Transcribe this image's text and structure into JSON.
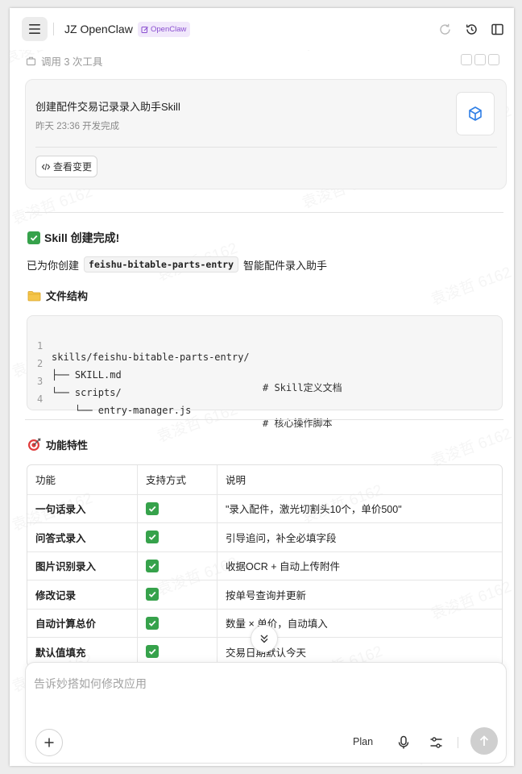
{
  "header": {
    "app_title": "JZ OpenClaw",
    "tag_label": "OpenClaw"
  },
  "tool_call": {
    "label": "调用 3 次工具"
  },
  "card": {
    "title": "创建配件交易记录录入助手Skill",
    "subtitle": "昨天 23:36 开发完成",
    "view_changes_label": "查看变更"
  },
  "message": {
    "done_heading": "Skill 创建完成!",
    "created_prefix": "已为你创建",
    "skill_name": "feishu-bitable-parts-entry",
    "created_suffix": "智能配件录入助手",
    "files_heading": "文件结构",
    "features_heading": "功能特性"
  },
  "code": {
    "lines": [
      {
        "num": "1",
        "text": "skills/feishu-bitable-parts-entry/",
        "comment": ""
      },
      {
        "num": "2",
        "text": "├── SKILL.md",
        "comment": "# Skill定义文档"
      },
      {
        "num": "3",
        "text": "└── scripts/",
        "comment": ""
      },
      {
        "num": "4",
        "text": "    └── entry-manager.js",
        "comment": "# 核心操作脚本"
      }
    ]
  },
  "table": {
    "headers": [
      "功能",
      "支持方式",
      "说明"
    ],
    "rows": [
      {
        "feature": "一句话录入",
        "support": "✅",
        "desc": "\"录入配件，激光切割头10个，单价500\""
      },
      {
        "feature": "问答式录入",
        "support": "✅",
        "desc": "引导追问，补全必填字段"
      },
      {
        "feature": "图片识别录入",
        "support": "✅",
        "desc": "收据OCR + 自动上传附件"
      },
      {
        "feature": "修改记录",
        "support": "✅",
        "desc": "按单号查询并更新"
      },
      {
        "feature": "自动计算总价",
        "support": "✅",
        "desc": "数量 × 单价，自动填入"
      },
      {
        "feature": "默认值填充",
        "support": "✅",
        "desc": "交易日期默认今天"
      }
    ]
  },
  "composer": {
    "placeholder": "告诉妙搭如何修改应用",
    "plan_label": "Plan"
  },
  "watermark": "袁浚哲 6162",
  "colors": {
    "accent": "#8a4fd0",
    "check_green": "#36a24b"
  }
}
